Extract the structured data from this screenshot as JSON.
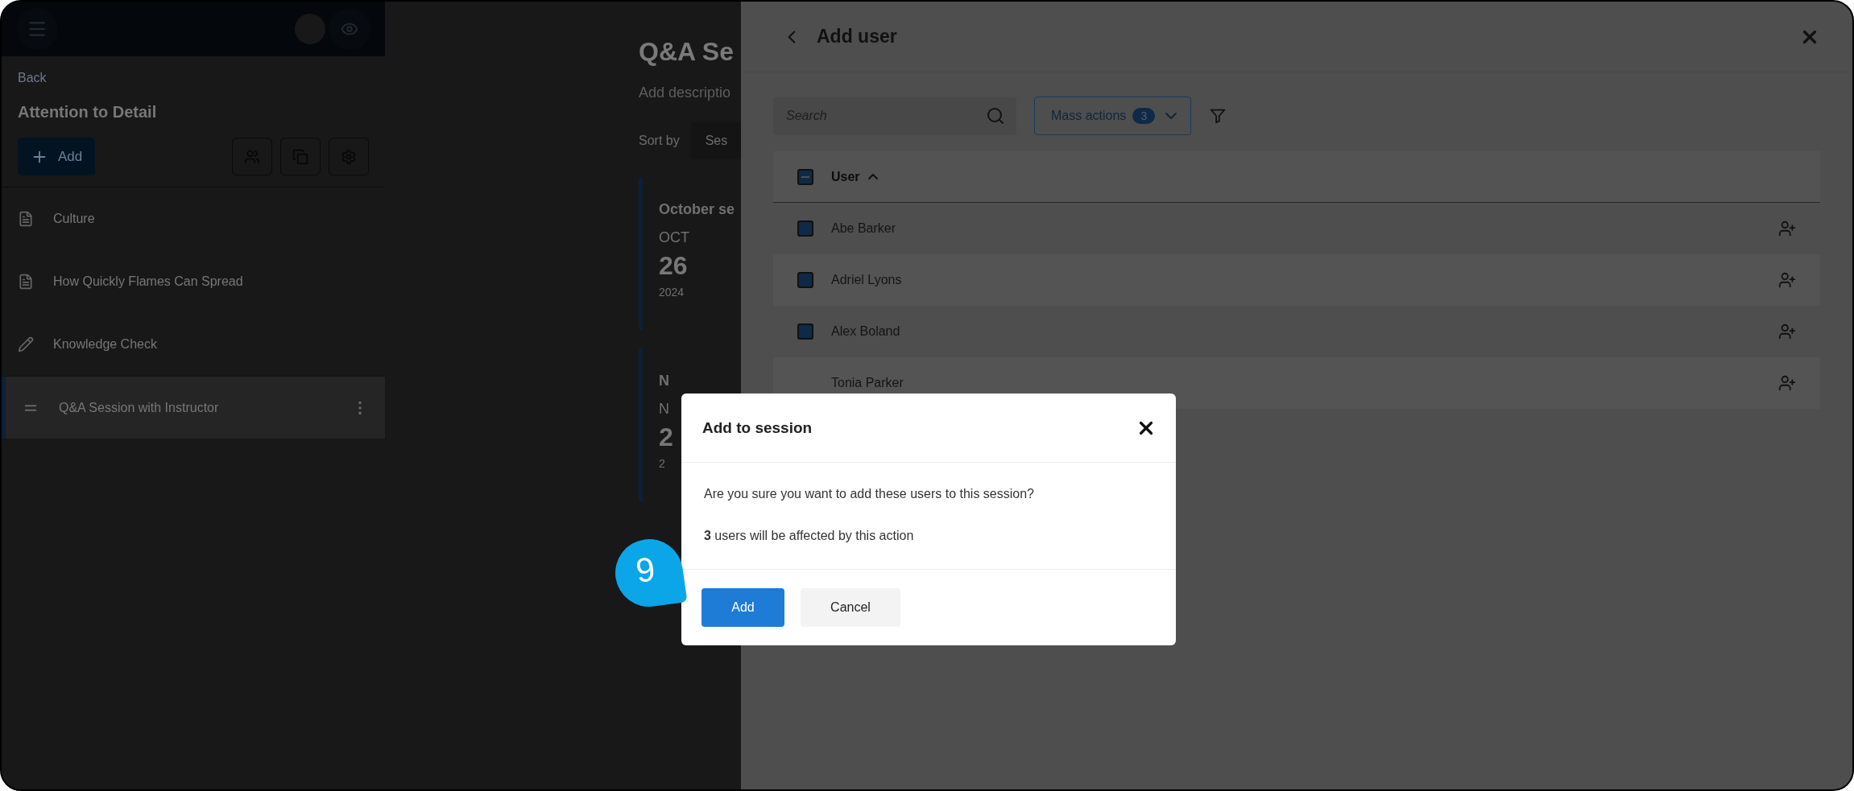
{
  "sidebar": {
    "back": "Back",
    "title": "Attention to Detail",
    "add_button": "Add",
    "items": [
      {
        "label": "Culture",
        "kind": "document",
        "selected": false
      },
      {
        "label": "How Quickly Flames Can Spread",
        "kind": "document",
        "selected": false
      },
      {
        "label": "Knowledge Check",
        "kind": "quiz",
        "selected": false
      },
      {
        "label": "Q&A Session with Instructor",
        "kind": "session",
        "selected": true
      }
    ]
  },
  "main": {
    "title": "Q&A Se",
    "description_placeholder": "Add descriptio",
    "sort_label": "Sort by",
    "sort_value": "Ses",
    "sessions": [
      {
        "title": "October se",
        "month": "OCT",
        "day": "26",
        "year": "2024"
      },
      {
        "title": "N",
        "month": "N",
        "day": "2",
        "year": "2"
      }
    ]
  },
  "panel": {
    "title": "Add user",
    "search": {
      "placeholder": "Search"
    },
    "mass_actions": {
      "label": "Mass actions",
      "count": "3"
    },
    "table": {
      "column": "User",
      "indeterminate": true,
      "rows": [
        {
          "name": "Abe Barker",
          "checked": true
        },
        {
          "name": "Adriel Lyons",
          "checked": true
        },
        {
          "name": "Alex Boland",
          "checked": true
        },
        {
          "name": "Tonia Parker",
          "checked": false
        }
      ]
    }
  },
  "dialog": {
    "title": "Add to session",
    "message": "Are you sure you want to add these users to this session?",
    "note": "**3** users will be affected by this action",
    "buttons": [
      {
        "label": "Add",
        "kind": "primary"
      },
      {
        "label": "Cancel",
        "kind": "secondary"
      }
    ]
  },
  "step_marker": "9"
}
